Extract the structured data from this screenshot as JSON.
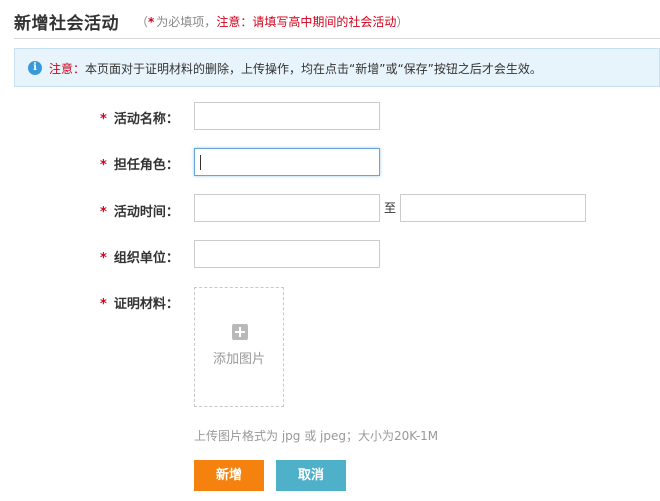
{
  "header": {
    "title": "新增社会活动",
    "hint_open": "（",
    "hint_required_mark": "*",
    "hint_required_text": "为必填项，",
    "hint_notice": "注意：请填写高中期间的社会活动",
    "hint_close": "）"
  },
  "alert": {
    "icon": "info-icon",
    "label": "注意：",
    "text": "本页面对于证明材料的删除，上传操作，均在点击“新增”或“保存”按钮之后才会生效。"
  },
  "form": {
    "required_mark": "*",
    "activity_name": {
      "label": "活动名称：",
      "value": ""
    },
    "role": {
      "label": "担任角色：",
      "value": ""
    },
    "activity_time": {
      "label": "活动时间：",
      "start": "",
      "separator": "至",
      "end": ""
    },
    "organizer": {
      "label": "组织单位：",
      "value": ""
    },
    "proof": {
      "label": "证明材料：",
      "upload_label": "添加图片",
      "upload_icon": "plus-icon",
      "note": "上传图片格式为 jpg 或 jpeg；大小为20K-1M"
    }
  },
  "buttons": {
    "add": "新增",
    "cancel": "取消"
  },
  "colors": {
    "required": "#d0021b",
    "add_button": "#f5820f",
    "cancel_button": "#4fb1c9",
    "alert_bg": "#e8f4fb",
    "focus_border": "#66a5d6"
  }
}
